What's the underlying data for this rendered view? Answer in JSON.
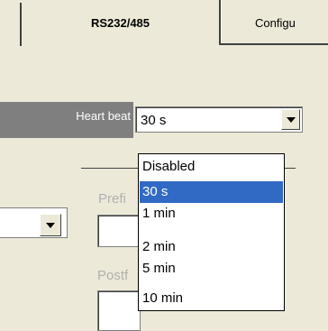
{
  "tabs": {
    "active": "RS232/485",
    "next": "Configu"
  },
  "heartbeat": {
    "label": "Heart beat",
    "value": "30 s",
    "options": [
      "Disabled",
      "30 s",
      "1 min",
      "2 min",
      "5 min",
      "10 min"
    ],
    "selected_index": 1
  },
  "fields": {
    "prefix_label": "Prefi",
    "postfix_label": "Postf"
  },
  "colors": {
    "selection": "#316ac5",
    "label_box": "#7f7f7f",
    "panel": "#ece9d8"
  }
}
